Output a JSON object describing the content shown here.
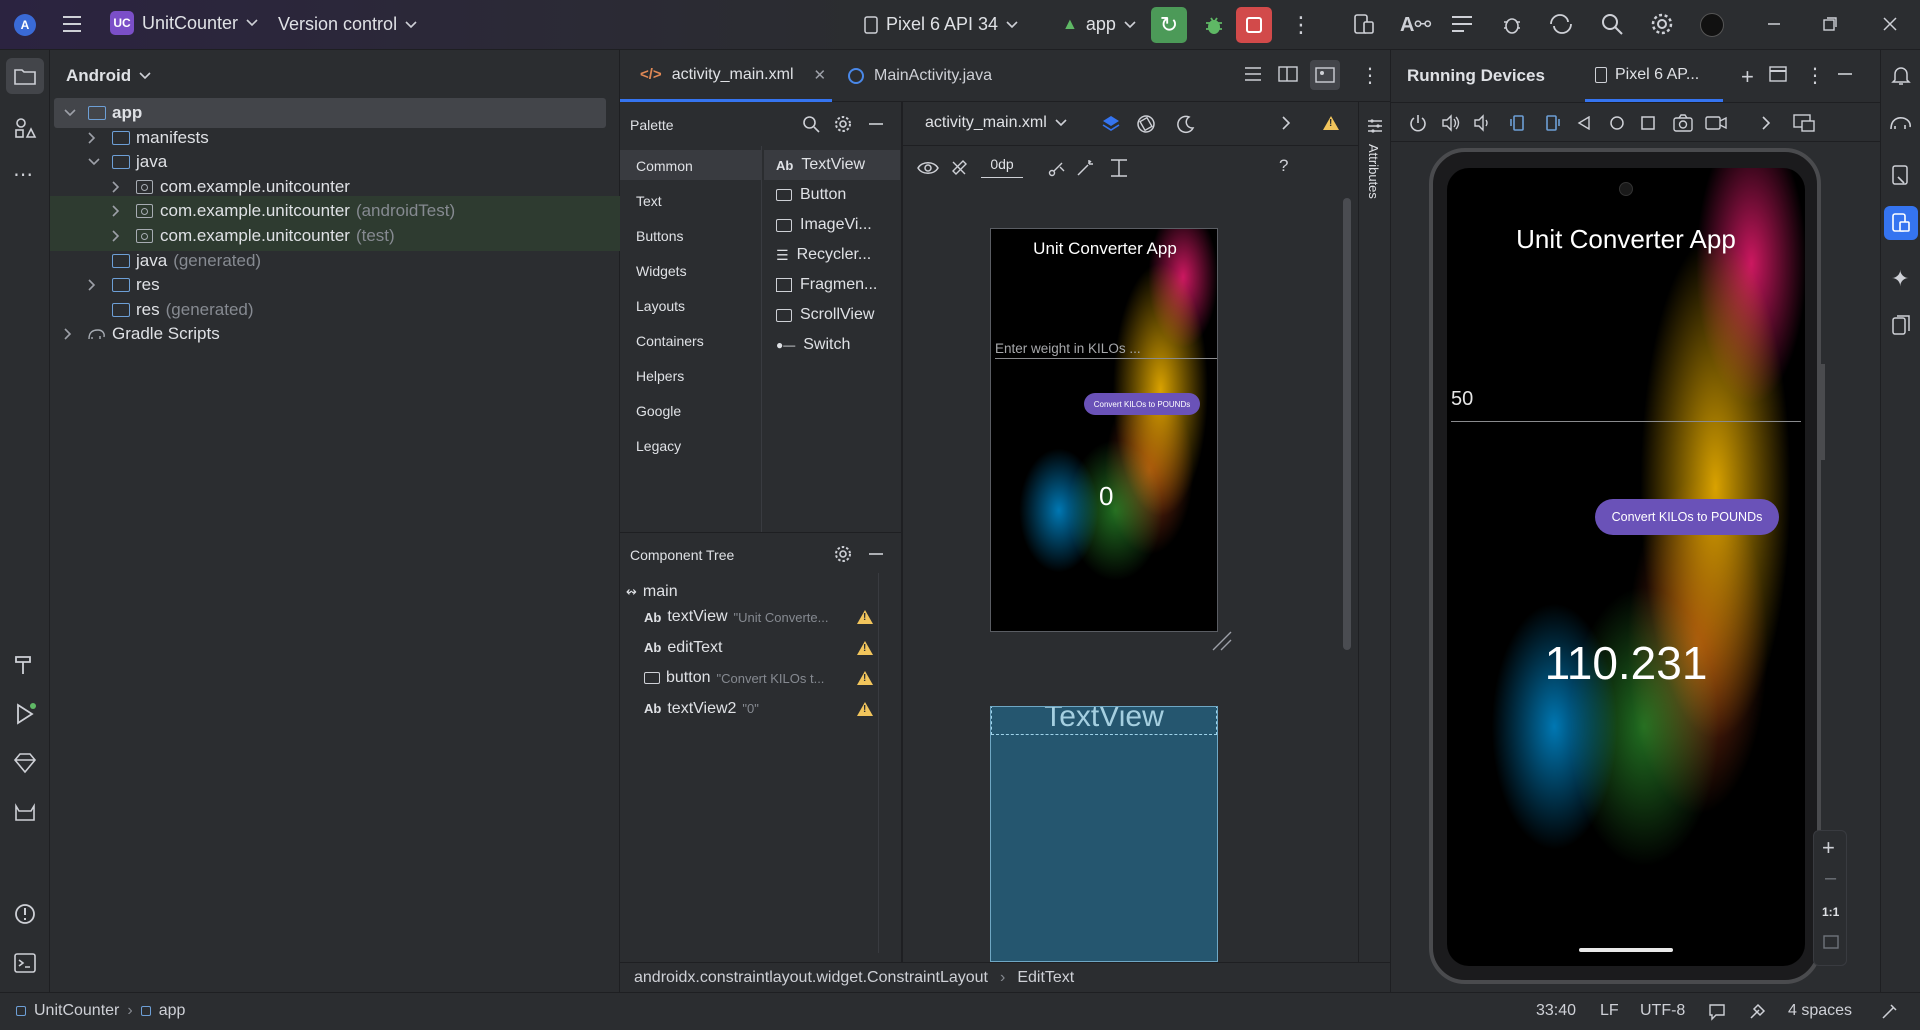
{
  "titlebar": {
    "project_badge": "UC",
    "project_name": "UnitCounter",
    "vcs": "Version control",
    "device": "Pixel 6 API 34",
    "run_config": "app"
  },
  "left_tools": [
    "folder-icon",
    "structure-icon",
    "more-icon",
    "build-icon",
    "run-icon",
    "gem-icon",
    "cat-icon",
    "problems-icon",
    "terminal-icon",
    "git-icon"
  ],
  "project": {
    "view": "Android",
    "tree": [
      {
        "label": "app",
        "muted": "",
        "kind": "app-folder",
        "indent": 0,
        "chevron": "down",
        "selected": true
      },
      {
        "label": "manifests",
        "muted": "",
        "kind": "folder",
        "indent": 1,
        "chevron": "right"
      },
      {
        "label": "java",
        "muted": "",
        "kind": "folder",
        "indent": 1,
        "chevron": "down"
      },
      {
        "label": "com.example.unitcounter",
        "muted": "",
        "kind": "pkg",
        "indent": 2,
        "chevron": "right"
      },
      {
        "label": "com.example.unitcounter",
        "muted": "(androidTest)",
        "kind": "pkg",
        "indent": 2,
        "chevron": "right",
        "green": true
      },
      {
        "label": "com.example.unitcounter",
        "muted": "(test)",
        "kind": "pkg",
        "indent": 2,
        "chevron": "right",
        "green": true
      },
      {
        "label": "java",
        "muted": "(generated)",
        "kind": "folder",
        "indent": 1,
        "chevron": ""
      },
      {
        "label": "res",
        "muted": "",
        "kind": "folder",
        "indent": 1,
        "chevron": "right"
      },
      {
        "label": "res",
        "muted": "(generated)",
        "kind": "folder",
        "indent": 1,
        "chevron": ""
      },
      {
        "label": "Gradle Scripts",
        "muted": "",
        "kind": "gradle",
        "indent": 0,
        "chevron": "right"
      }
    ]
  },
  "editor": {
    "tabs": [
      {
        "label": "activity_main.xml",
        "active": true
      },
      {
        "label": "MainActivity.java",
        "active": false
      }
    ]
  },
  "palette": {
    "title": "Palette",
    "categories": [
      "Common",
      "Text",
      "Buttons",
      "Widgets",
      "Layouts",
      "Containers",
      "Helpers",
      "Google",
      "Legacy"
    ],
    "items": [
      "TextView",
      "Button",
      "ImageVi...",
      "Recycler...",
      "Fragmen...",
      "ScrollView",
      "Switch"
    ]
  },
  "component_tree": {
    "title": "Component Tree",
    "root": "main",
    "items": [
      {
        "prefix": "Ab",
        "name": "textView",
        "hint": "\"Unit Converte..."
      },
      {
        "prefix": "Ab",
        "name": "editText",
        "hint": ""
      },
      {
        "prefix": "",
        "name": "button",
        "hint": "\"Convert KILOs t..."
      },
      {
        "prefix": "Ab",
        "name": "textView2",
        "hint": "\"0\""
      }
    ]
  },
  "design": {
    "file": "activity_main.xml",
    "margin": "0dp",
    "preview": {
      "title": "Unit Converter App",
      "hint": "Enter weight in KILOs ...",
      "button": "Convert KILOs to POUNDs",
      "result": "0"
    },
    "blueprint_label": "TextView",
    "attributes_label": "Attributes"
  },
  "breadcrumbs": [
    "androidx.constraintlayout.widget.ConstraintLayout",
    "EditText"
  ],
  "running": {
    "title": "Running Devices",
    "tab": "Pixel 6 AP...",
    "app": {
      "title": "Unit Converter App",
      "input": "50",
      "button": "Convert KILOs to POUNDs",
      "result": "110.231"
    },
    "zoom_label": "1:1"
  },
  "status": {
    "project": "UnitCounter",
    "module": "app",
    "position": "33:40",
    "line_ending": "LF",
    "encoding": "UTF-8",
    "indent": "4 spaces"
  }
}
